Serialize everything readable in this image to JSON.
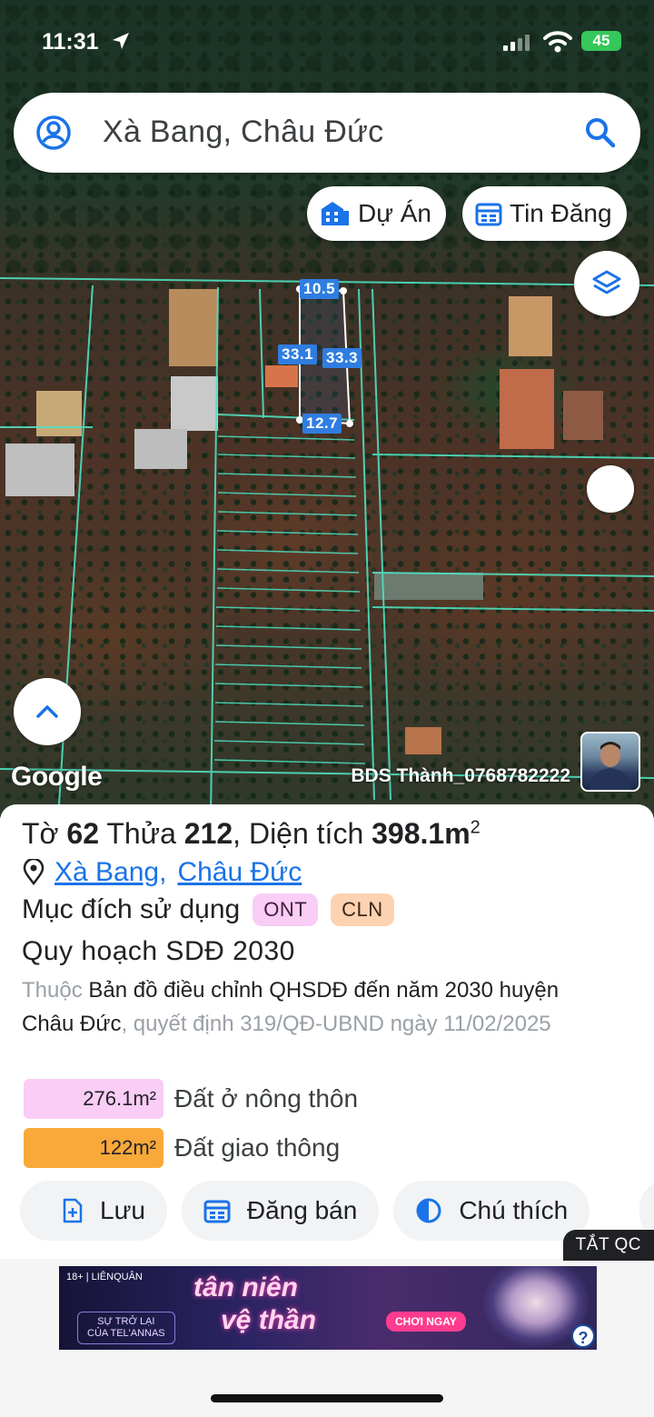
{
  "status_bar": {
    "time": "11:31",
    "battery": "45"
  },
  "search": {
    "query": "Xà Bang, Châu Đức"
  },
  "chips": {
    "projects": "Dự Án",
    "listings": "Tin Đăng"
  },
  "map": {
    "dimensions": {
      "top": "10.5",
      "left": "33.1",
      "right": "33.3",
      "bottom": "12.7"
    },
    "logo": "Google",
    "watermark": "BDS Thành_0768782222"
  },
  "parcel": {
    "sheet_label": "Tờ",
    "sheet_no": "62",
    "plot_label": "Thửa",
    "plot_no": "212",
    "area_label": "Diện tích",
    "area_value": "398.1m",
    "area_unit_sup": "2",
    "ward": "Xà Bang",
    "district": "Châu Đức",
    "purpose_label": "Mục đích sử dụng",
    "purpose_tags": [
      "ONT",
      "CLN"
    ],
    "planning_title": "Quy hoạch SDĐ 2030",
    "desc_prefix": "Thuộc",
    "desc_map": "Bản đồ điều chỉnh QHSDĐ đến năm 2030 huyện Châu Đức",
    "desc_decision": ", quyết định 319/QĐ-UBND ngày 11/02/2025",
    "areas": [
      {
        "value": "276.1m²",
        "label": "Đất ở nông thôn",
        "color": "#f9cdf6"
      },
      {
        "value": "122m²",
        "label": "Đất giao thông",
        "color": "#f9a83a"
      }
    ]
  },
  "actions": {
    "save": "Lưu",
    "post": "Đăng bán",
    "legend": "Chú thích"
  },
  "ads": {
    "close_label": "TẮT QC",
    "brand": "18+ | LIÊNQUÂN",
    "sub_line1": "SỰ TRỞ LẠI",
    "sub_line2": "CỦA TEL'ANNAS",
    "headline_line1": "tân niên",
    "headline_line2": "vệ thần",
    "cta": "CHƠI NGAY",
    "help": "?"
  },
  "colors": {
    "accent": "#1a73e8",
    "parcel_lines": "#4fe0c0",
    "dim_label": "#2f7de1"
  }
}
